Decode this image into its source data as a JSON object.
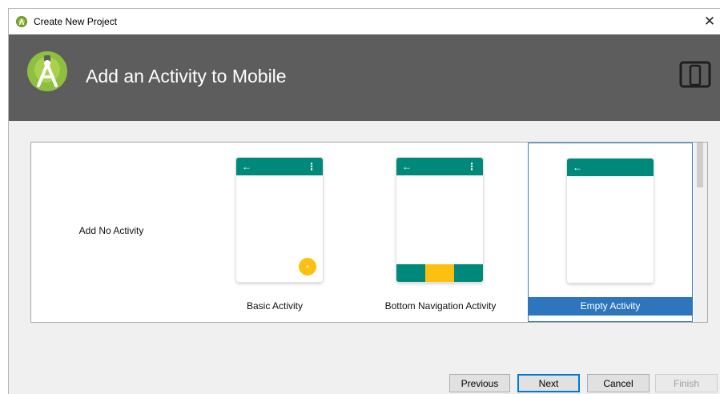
{
  "window": {
    "title": "Create New Project",
    "close_glyph": "✕"
  },
  "header": {
    "heading": "Add an Activity to Mobile",
    "logo_icon": "android-studio-logo-icon",
    "device_icon": "tablet-phone-icon"
  },
  "gallery": {
    "tiles": [
      {
        "label": "Add No Activity"
      },
      {
        "label": "Basic Activity",
        "back_glyph": "←",
        "menu_glyph": "⋮",
        "fab_glyph": "+"
      },
      {
        "label": "Bottom Navigation Activity",
        "back_glyph": "←",
        "menu_glyph": "⋮"
      },
      {
        "label": "Empty Activity",
        "back_glyph": "←",
        "selected": true
      }
    ]
  },
  "buttons": {
    "previous": "Previous",
    "next": "Next",
    "cancel": "Cancel",
    "finish": "Finish"
  },
  "colors": {
    "header_bg": "#5d5d5d",
    "toolbar_teal": "#00897b",
    "fab_yellow": "#fdc010",
    "selection_blue": "#2d76be"
  }
}
